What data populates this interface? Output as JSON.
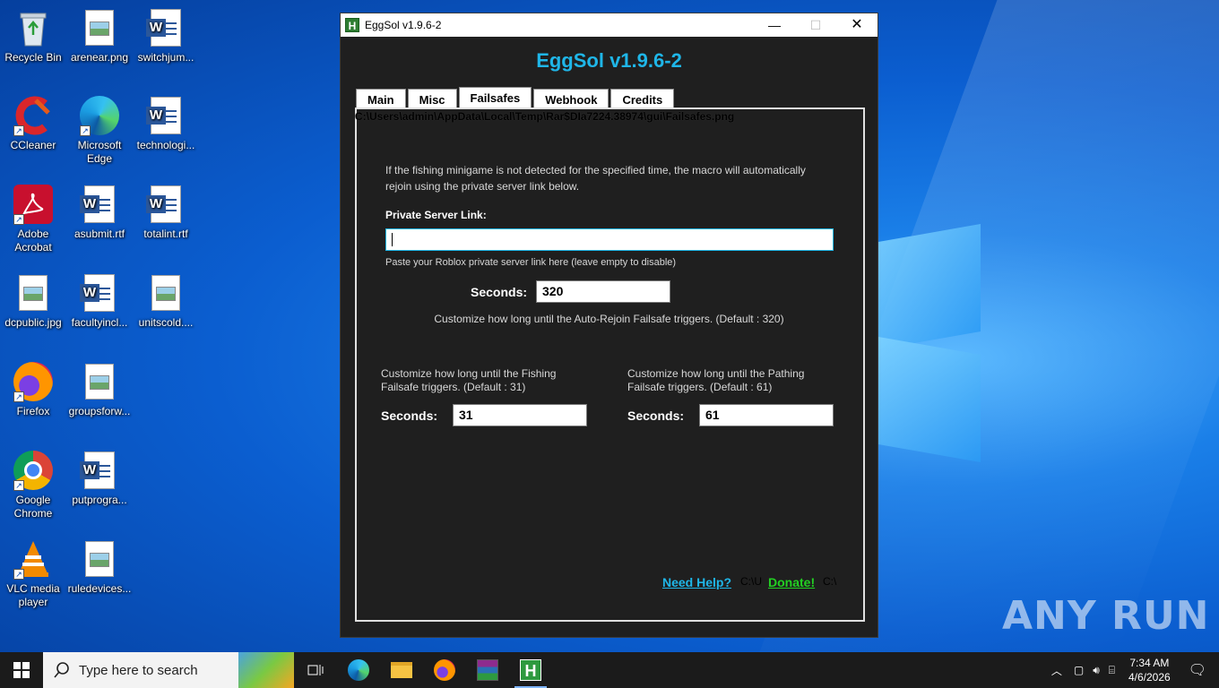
{
  "desktop": {
    "icons": [
      {
        "label": "Recycle Bin",
        "icon": "recycle-bin-icon"
      },
      {
        "label": "arenear.png",
        "icon": "image-file-icon"
      },
      {
        "label": "switchjum...",
        "icon": "word-doc-icon"
      },
      {
        "label": "CCleaner",
        "icon": "ccleaner-icon"
      },
      {
        "label": "Microsoft Edge",
        "icon": "edge-icon"
      },
      {
        "label": "technologi...",
        "icon": "word-doc-icon"
      },
      {
        "label": "Adobe Acrobat",
        "icon": "acrobat-icon"
      },
      {
        "label": "asubmit.rtf",
        "icon": "word-doc-icon"
      },
      {
        "label": "totalint.rtf",
        "icon": "word-doc-icon"
      },
      {
        "label": "dcpublic.jpg",
        "icon": "image-file-icon"
      },
      {
        "label": "facultyincl...",
        "icon": "word-doc-icon"
      },
      {
        "label": "unitscold....",
        "icon": "image-file-icon"
      },
      {
        "label": "Firefox",
        "icon": "firefox-icon"
      },
      {
        "label": "groupsforw...",
        "icon": "image-file-icon"
      },
      {
        "label": "Google Chrome",
        "icon": "chrome-icon"
      },
      {
        "label": "putprogra...",
        "icon": "word-doc-icon"
      },
      {
        "label": "VLC media player",
        "icon": "vlc-icon"
      },
      {
        "label": "ruledevices...",
        "icon": "image-file-icon"
      }
    ],
    "watermark": "ANY RUN"
  },
  "window": {
    "title": "EggSol v1.9.6-2",
    "app_icon_letter": "H",
    "minimize": "—",
    "maximize": "☐",
    "close": "✕",
    "heading": "EggSol v1.9.6-2",
    "tabs": [
      "Main",
      "Misc",
      "Failsafes",
      "Webhook",
      "Credits"
    ],
    "active_tab": "Failsafes",
    "path_overlay": "C:\\Users\\admin\\AppData\\Local\\Temp\\Rar$DIa7224.38974\\gui\\Failsafes.png",
    "failsafes": {
      "intro": "If the fishing minigame is not detected for the specified time, the macro will automatically rejoin using the private server link below.",
      "private_server_label": "Private Server Link:",
      "private_server_value": "",
      "private_server_hint": "Paste your Roblox private server link here (leave empty to disable)",
      "rejoin_seconds_label": "Seconds:",
      "rejoin_seconds_value": "320",
      "rejoin_desc": "Customize how long until the Auto-Rejoin Failsafe triggers. (Default : 320)",
      "fishing_desc": "Customize how long until the Fishing Failsafe triggers. (Default : 31)",
      "fishing_seconds_label": "Seconds:",
      "fishing_seconds_value": "31",
      "pathing_desc": "Customize how long until the Pathing Failsafe triggers. (Default : 61)",
      "pathing_seconds_label": "Seconds:",
      "pathing_seconds_value": "61"
    },
    "footer": {
      "help_link": "Need Help?",
      "help_color": "#1fb6e8",
      "ghost1": "C:\\U",
      "donate_link": "Donate!",
      "donate_color": "#22d022",
      "ghost2": "C:\\"
    }
  },
  "taskbar": {
    "search_placeholder": "Type here to search",
    "apps": [
      "task-view-icon",
      "edge-icon",
      "file-explorer-icon",
      "firefox-icon",
      "winrar-icon",
      "eggsol-icon"
    ],
    "time": "7:34 AM",
    "date": "4/6/2026"
  }
}
